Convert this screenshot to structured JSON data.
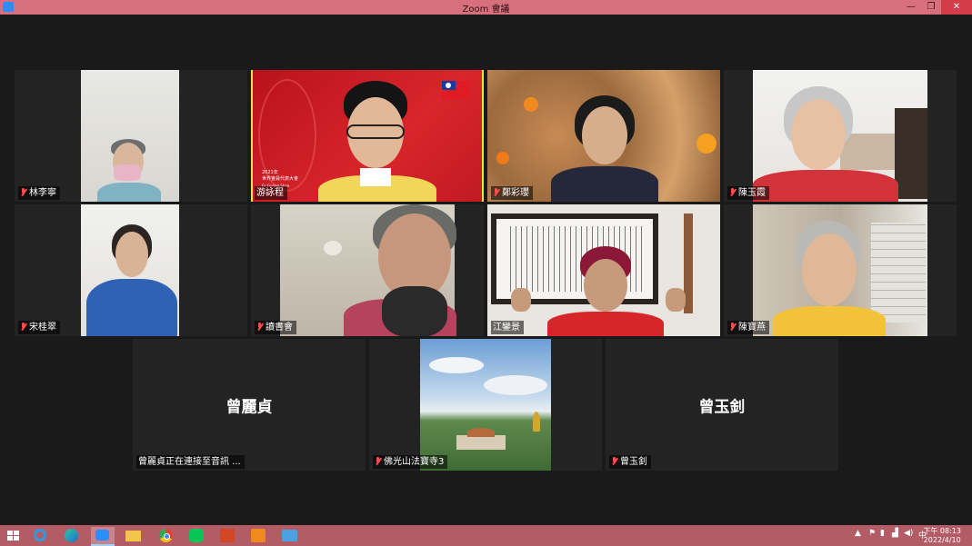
{
  "window": {
    "title": "Zoom 會議",
    "minimize": "—",
    "maximize": "❐",
    "close": "✕"
  },
  "participants": [
    {
      "name": "林李寧"
    },
    {
      "name": "游詠程",
      "banner_year": "2021年",
      "banner_line1": "世界會員代表大會",
      "banner_line2": "Fo Guang Shan"
    },
    {
      "name": "鄭彩瓔"
    },
    {
      "name": "陳玉霞"
    },
    {
      "name": "宋桂翠"
    },
    {
      "name": "讀書會"
    },
    {
      "name": "江鑾景"
    },
    {
      "name": "陳寶燕"
    },
    {
      "name": "曾麗貞",
      "display": "曾麗貞",
      "status": "曾麗貞正在連接至音訊 ..."
    },
    {
      "name": "佛光山法寶寺3"
    },
    {
      "name": "曾玉釗",
      "display": "曾玉釗"
    }
  ],
  "taskbar": {
    "apps": [
      "windows-start",
      "internet-explorer",
      "edge",
      "zoom",
      "file-explorer",
      "chrome",
      "line",
      "powerpoint",
      "media-player",
      "photos"
    ],
    "clock_time": "下午 08:13",
    "clock_date": "2022/4/10",
    "tray_ime": "中"
  },
  "colors": {
    "titlebar": "#d7707c",
    "taskbar": "#b35c66",
    "active_border": "#e6e64a",
    "muted_mic": "#ff4d4d"
  }
}
